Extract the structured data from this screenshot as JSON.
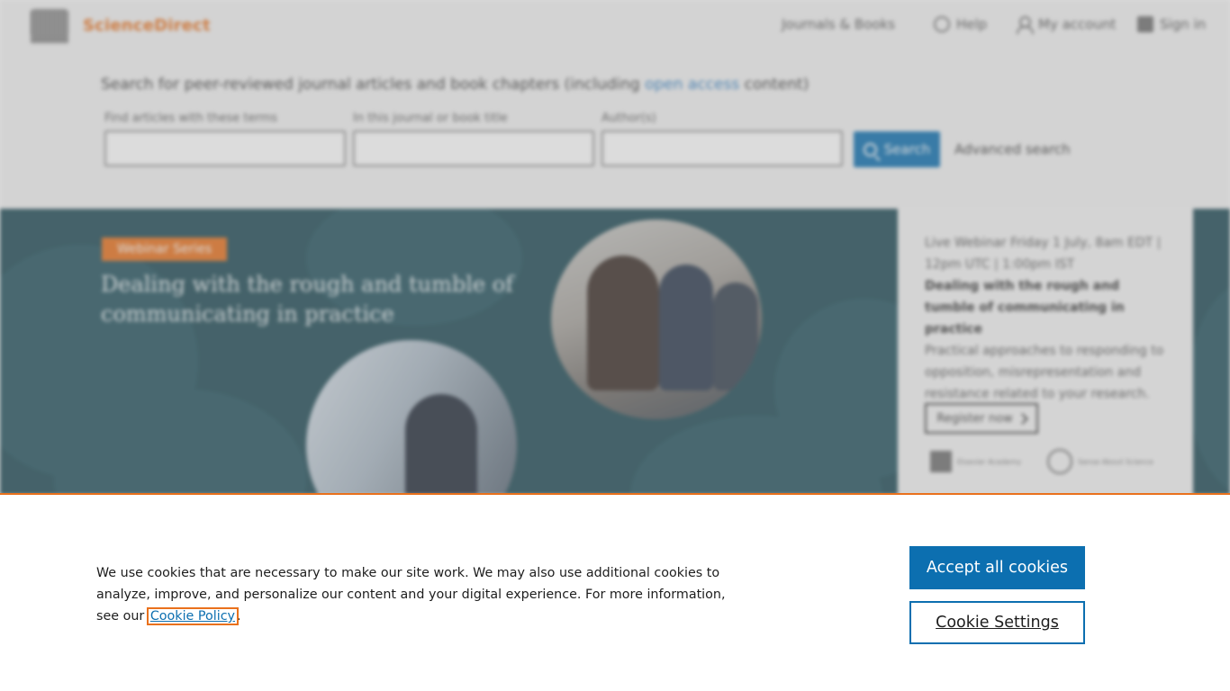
{
  "header": {
    "logo_text": "ScienceDirect",
    "nav": {
      "journals_books": "Journals & Books",
      "help": "Help",
      "my_account": "My account",
      "sign_in": "Sign in"
    }
  },
  "search": {
    "title_prefix": "Search for peer-reviewed journal articles and book chapters (including ",
    "title_link": "open access",
    "title_suffix": " content)",
    "fields": [
      {
        "label": "Find articles with these terms",
        "value": ""
      },
      {
        "label": "In this journal or book title",
        "value": ""
      },
      {
        "label": "Author(s)",
        "value": ""
      }
    ],
    "button_label": "Search",
    "advanced_label": "Advanced search"
  },
  "hero": {
    "badge": "Webinar Series",
    "title": "Dealing with the rough and tumble of communicating in practice",
    "card": {
      "date": "Live Webinar Friday 1 July, 8am EDT | 12pm UTC | 1:00pm IST",
      "headline": "Dealing with the rough and tumble of communicating in practice",
      "description": "Practical approaches to responding to opposition, misrepresentation and resistance related to your research.",
      "register_label": "Register now",
      "sponsor_1": "Elsevier Academy",
      "sponsor_2": "Sense About Science"
    }
  },
  "cookie_banner": {
    "text": "We use cookies that are necessary to make our site work. We may also use additional cookies to analyze, improve, and personalize our content and your digital experience. For more information, see our ",
    "link": "Cookie Policy",
    "text_end": ".",
    "accept_label": "Accept all cookies",
    "settings_label": "Cookie Settings"
  },
  "colors": {
    "accent_orange": "#e9711c",
    "primary_blue": "#0c6fb0",
    "hero_teal": "#1e4a55"
  }
}
